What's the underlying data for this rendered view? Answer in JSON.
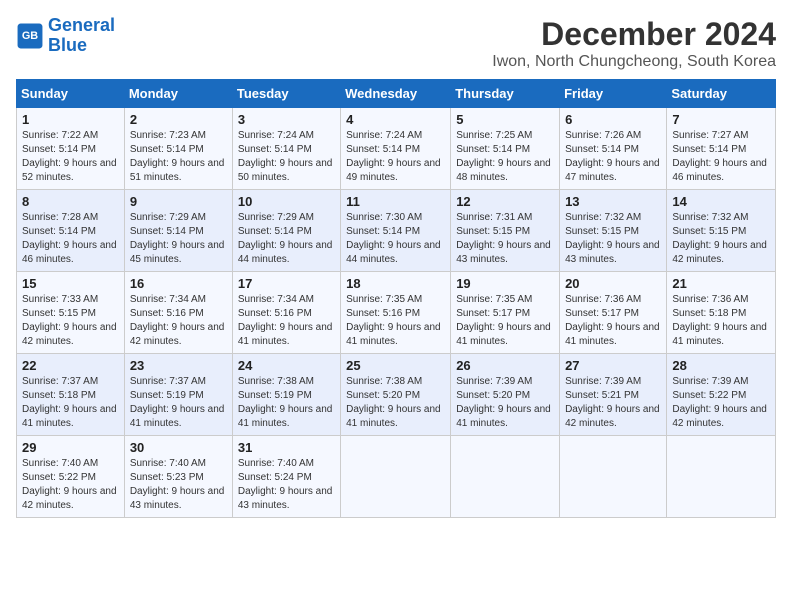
{
  "header": {
    "logo_line1": "General",
    "logo_line2": "Blue",
    "month": "December 2024",
    "location": "Iwon, North Chungcheong, South Korea"
  },
  "weekdays": [
    "Sunday",
    "Monday",
    "Tuesday",
    "Wednesday",
    "Thursday",
    "Friday",
    "Saturday"
  ],
  "weeks": [
    [
      {
        "day": "1",
        "sunrise": "7:22 AM",
        "sunset": "5:14 PM",
        "daylight": "9 hours and 52 minutes."
      },
      {
        "day": "2",
        "sunrise": "7:23 AM",
        "sunset": "5:14 PM",
        "daylight": "9 hours and 51 minutes."
      },
      {
        "day": "3",
        "sunrise": "7:24 AM",
        "sunset": "5:14 PM",
        "daylight": "9 hours and 50 minutes."
      },
      {
        "day": "4",
        "sunrise": "7:24 AM",
        "sunset": "5:14 PM",
        "daylight": "9 hours and 49 minutes."
      },
      {
        "day": "5",
        "sunrise": "7:25 AM",
        "sunset": "5:14 PM",
        "daylight": "9 hours and 48 minutes."
      },
      {
        "day": "6",
        "sunrise": "7:26 AM",
        "sunset": "5:14 PM",
        "daylight": "9 hours and 47 minutes."
      },
      {
        "day": "7",
        "sunrise": "7:27 AM",
        "sunset": "5:14 PM",
        "daylight": "9 hours and 46 minutes."
      }
    ],
    [
      {
        "day": "8",
        "sunrise": "7:28 AM",
        "sunset": "5:14 PM",
        "daylight": "9 hours and 46 minutes."
      },
      {
        "day": "9",
        "sunrise": "7:29 AM",
        "sunset": "5:14 PM",
        "daylight": "9 hours and 45 minutes."
      },
      {
        "day": "10",
        "sunrise": "7:29 AM",
        "sunset": "5:14 PM",
        "daylight": "9 hours and 44 minutes."
      },
      {
        "day": "11",
        "sunrise": "7:30 AM",
        "sunset": "5:14 PM",
        "daylight": "9 hours and 44 minutes."
      },
      {
        "day": "12",
        "sunrise": "7:31 AM",
        "sunset": "5:15 PM",
        "daylight": "9 hours and 43 minutes."
      },
      {
        "day": "13",
        "sunrise": "7:32 AM",
        "sunset": "5:15 PM",
        "daylight": "9 hours and 43 minutes."
      },
      {
        "day": "14",
        "sunrise": "7:32 AM",
        "sunset": "5:15 PM",
        "daylight": "9 hours and 42 minutes."
      }
    ],
    [
      {
        "day": "15",
        "sunrise": "7:33 AM",
        "sunset": "5:15 PM",
        "daylight": "9 hours and 42 minutes."
      },
      {
        "day": "16",
        "sunrise": "7:34 AM",
        "sunset": "5:16 PM",
        "daylight": "9 hours and 42 minutes."
      },
      {
        "day": "17",
        "sunrise": "7:34 AM",
        "sunset": "5:16 PM",
        "daylight": "9 hours and 41 minutes."
      },
      {
        "day": "18",
        "sunrise": "7:35 AM",
        "sunset": "5:16 PM",
        "daylight": "9 hours and 41 minutes."
      },
      {
        "day": "19",
        "sunrise": "7:35 AM",
        "sunset": "5:17 PM",
        "daylight": "9 hours and 41 minutes."
      },
      {
        "day": "20",
        "sunrise": "7:36 AM",
        "sunset": "5:17 PM",
        "daylight": "9 hours and 41 minutes."
      },
      {
        "day": "21",
        "sunrise": "7:36 AM",
        "sunset": "5:18 PM",
        "daylight": "9 hours and 41 minutes."
      }
    ],
    [
      {
        "day": "22",
        "sunrise": "7:37 AM",
        "sunset": "5:18 PM",
        "daylight": "9 hours and 41 minutes."
      },
      {
        "day": "23",
        "sunrise": "7:37 AM",
        "sunset": "5:19 PM",
        "daylight": "9 hours and 41 minutes."
      },
      {
        "day": "24",
        "sunrise": "7:38 AM",
        "sunset": "5:19 PM",
        "daylight": "9 hours and 41 minutes."
      },
      {
        "day": "25",
        "sunrise": "7:38 AM",
        "sunset": "5:20 PM",
        "daylight": "9 hours and 41 minutes."
      },
      {
        "day": "26",
        "sunrise": "7:39 AM",
        "sunset": "5:20 PM",
        "daylight": "9 hours and 41 minutes."
      },
      {
        "day": "27",
        "sunrise": "7:39 AM",
        "sunset": "5:21 PM",
        "daylight": "9 hours and 42 minutes."
      },
      {
        "day": "28",
        "sunrise": "7:39 AM",
        "sunset": "5:22 PM",
        "daylight": "9 hours and 42 minutes."
      }
    ],
    [
      {
        "day": "29",
        "sunrise": "7:40 AM",
        "sunset": "5:22 PM",
        "daylight": "9 hours and 42 minutes."
      },
      {
        "day": "30",
        "sunrise": "7:40 AM",
        "sunset": "5:23 PM",
        "daylight": "9 hours and 43 minutes."
      },
      {
        "day": "31",
        "sunrise": "7:40 AM",
        "sunset": "5:24 PM",
        "daylight": "9 hours and 43 minutes."
      },
      null,
      null,
      null,
      null
    ]
  ]
}
